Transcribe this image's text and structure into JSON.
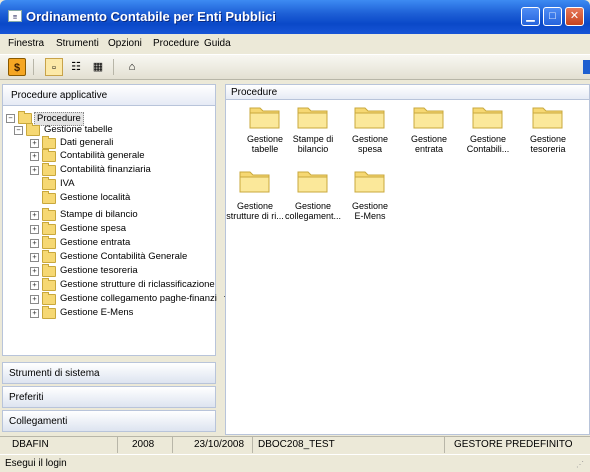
{
  "window": {
    "title": "Ordinamento Contabile per Enti Pubblici"
  },
  "menu": [
    "Finestra",
    "Strumenti",
    "Opzioni",
    "Procedure",
    "Guida"
  ],
  "left_panel": {
    "header": "Procedure applicative",
    "tree": [
      {
        "label": "Procedure",
        "level": 0,
        "expander": "minus"
      },
      {
        "label": "Gestione tabelle",
        "level": 1,
        "expander": "minus"
      },
      {
        "label": "Dati generali",
        "level": 2,
        "expander": "plus"
      },
      {
        "label": "Contabilità generale",
        "level": 2,
        "expander": "plus"
      },
      {
        "label": "Contabilità finanziaria",
        "level": 2,
        "expander": "plus"
      },
      {
        "label": "IVA",
        "level": 2,
        "expander": "none"
      },
      {
        "label": "Gestione località",
        "level": 2,
        "expander": "none"
      },
      {
        "label": "Stampe di bilancio",
        "level": 1,
        "expander": "plus"
      },
      {
        "label": "Gestione spesa",
        "level": 1,
        "expander": "plus"
      },
      {
        "label": "Gestione entrata",
        "level": 1,
        "expander": "plus"
      },
      {
        "label": "Gestione Contabilità Generale",
        "level": 1,
        "expander": "plus"
      },
      {
        "label": "Gestione tesoreria",
        "level": 1,
        "expander": "plus"
      },
      {
        "label": "Gestione strutture di riclassificazione",
        "level": 1,
        "expander": "plus"
      },
      {
        "label": "Gestione collegamento paghe-finanziaria",
        "level": 1,
        "expander": "plus"
      },
      {
        "label": "Gestione E-Mens",
        "level": 1,
        "expander": "plus"
      }
    ],
    "sections": [
      "Strumenti di sistema",
      "Preferiti",
      "Collegamenti"
    ]
  },
  "right_panel": {
    "header": "Procedure",
    "icons": [
      {
        "line1": "Gestione",
        "line2": "tabelle"
      },
      {
        "line1": "Stampe di",
        "line2": "bilancio"
      },
      {
        "line1": "Gestione",
        "line2": "spesa"
      },
      {
        "line1": "Gestione",
        "line2": "entrata"
      },
      {
        "line1": "Gestione",
        "line2": "Contabili..."
      },
      {
        "line1": "Gestione",
        "line2": "tesoreria"
      },
      {
        "line1": "Gestione",
        "line2": "strutture di ri..."
      },
      {
        "line1": "Gestione",
        "line2": "collegament..."
      },
      {
        "line1": "Gestione",
        "line2": "E-Mens"
      }
    ]
  },
  "status": {
    "db": "DBAFIN",
    "year": "2008",
    "date": "23/10/2008",
    "instance": "DBOC208_TEST",
    "manager": "GESTORE PREDEFINITO",
    "message": "Esegui il login"
  },
  "colors": {
    "title_bar": "#0A48C8",
    "folder": "#F6D873",
    "panel_border": "#B8C4DA"
  }
}
